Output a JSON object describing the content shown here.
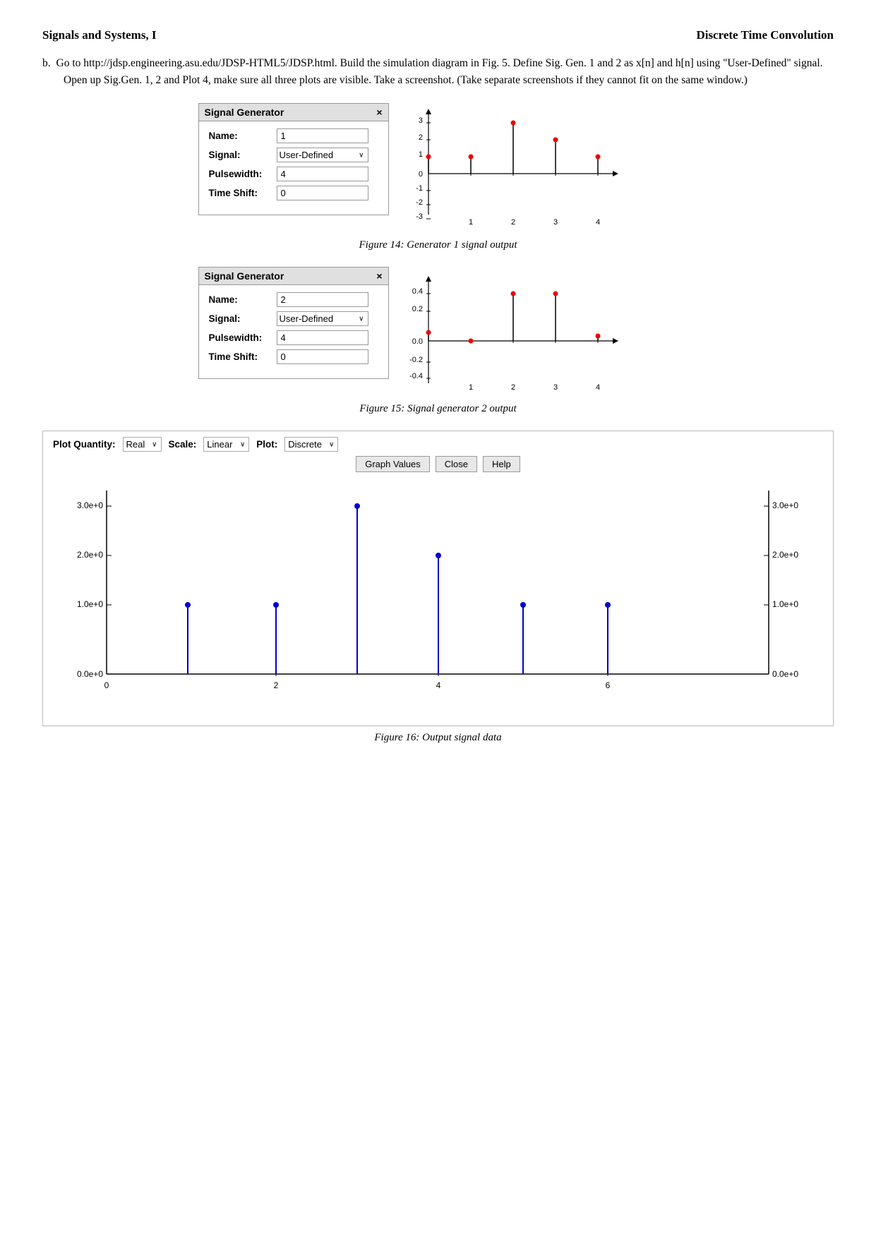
{
  "header": {
    "left": "Signals and Systems, I",
    "right": "Discrete Time Convolution"
  },
  "problem": {
    "label": "b.",
    "text": "Go to http://jdsp.engineering.asu.edu/JDSP-HTML5/JDSP.html. Build the simulation diagram in Fig. 5. Define Sig. Gen. 1 and 2 as x[n] and h[n] using \"User-Defined\" signal. Open up Sig.Gen. 1, 2 and Plot 4, make sure all three plots are visible. Take a screenshot. (Take separate screenshots if they cannot fit on the same window.)"
  },
  "fig14": {
    "caption": "Figure 14: Generator 1 signal output",
    "siggen": {
      "title": "Signal Generator",
      "close": "×",
      "name_label": "Name:",
      "name_value": "1",
      "signal_label": "Signal:",
      "signal_value": "User-Defined",
      "pulsewidth_label": "Pulsewidth:",
      "pulsewidth_value": "4",
      "timeshift_label": "Time Shift:",
      "timeshift_value": "0"
    }
  },
  "fig15": {
    "caption": "Figure 15: Signal generator 2 output",
    "siggen": {
      "title": "Signal Generator",
      "close": "×",
      "name_label": "Name:",
      "name_value": "2",
      "signal_label": "Signal:",
      "signal_value": "User-Defined",
      "pulsewidth_label": "Pulsewidth:",
      "pulsewidth_value": "4",
      "timeshift_label": "Time Shift:",
      "timeshift_value": "0"
    }
  },
  "fig16": {
    "caption": "Figure 16: Output signal data",
    "controls": {
      "plot_quantity_label": "Plot Quantity:",
      "plot_quantity_value": "Real",
      "scale_label": "Scale:",
      "scale_value": "Linear",
      "plot_label": "Plot:",
      "plot_value": "Discrete",
      "btn_graph": "Graph Values",
      "btn_close": "Close",
      "btn_help": "Help"
    }
  }
}
